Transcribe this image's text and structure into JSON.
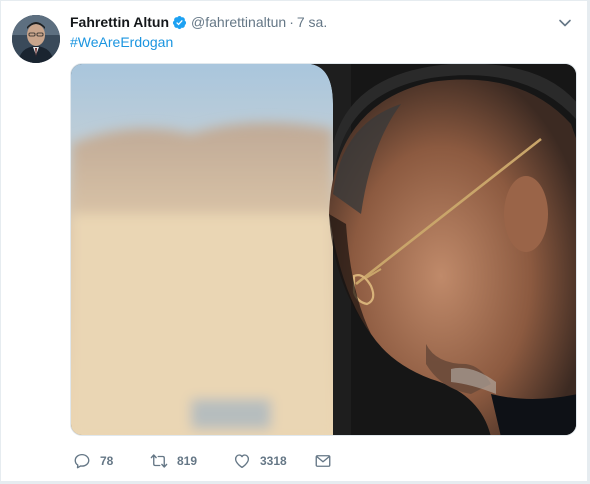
{
  "tweet": {
    "author": {
      "name": "Fahrettin Altun",
      "handle": "@fahrettinaltun",
      "verified": true,
      "avatar_icon": "profile-photo"
    },
    "separator": "·",
    "time": "7 sa.",
    "hashtag": "#WeAreErdogan",
    "menu_icon": "chevron-down-icon"
  },
  "actions": {
    "reply": {
      "icon": "reply-icon",
      "count": "78"
    },
    "retweet": {
      "icon": "retweet-icon",
      "count": "819"
    },
    "like": {
      "icon": "heart-icon",
      "count": "3318"
    },
    "dm": {
      "icon": "envelope-icon"
    }
  },
  "colors": {
    "link": "#1b95e0",
    "secondary_text": "#657786",
    "verified": "#1da1f2",
    "border": "#e6ecf0"
  }
}
